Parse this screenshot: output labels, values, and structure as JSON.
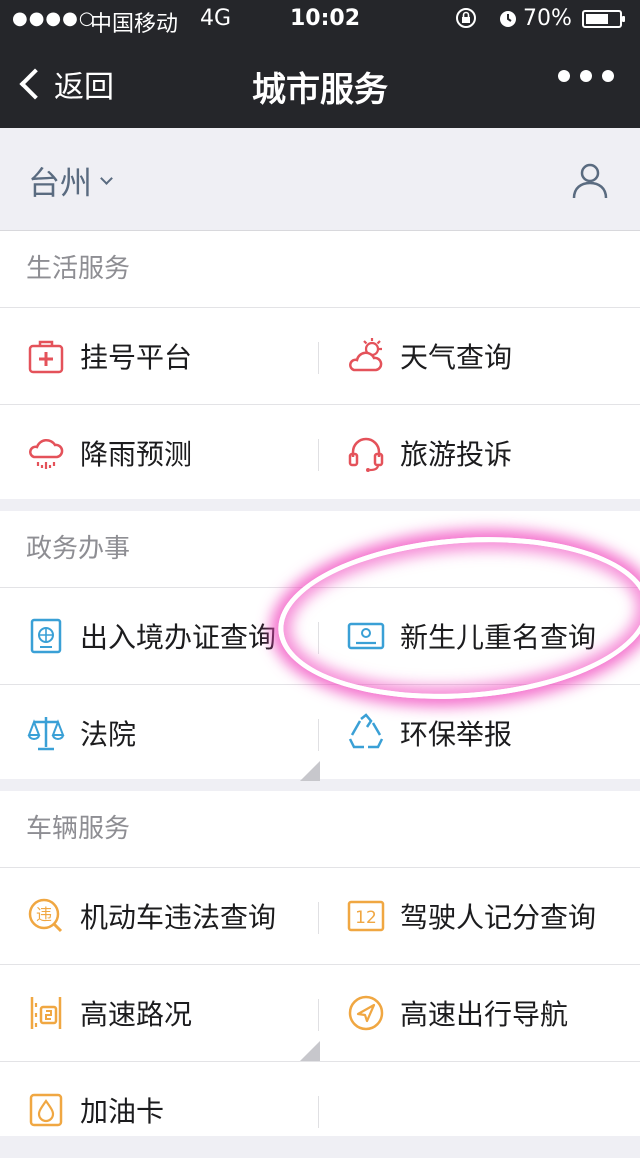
{
  "status_bar": {
    "signal": "●●●●○",
    "carrier": "中国移动",
    "network": "4G",
    "time": "10:02",
    "battery_percent": "70%",
    "battery_level": 0.7
  },
  "nav": {
    "back_label": "返回",
    "title": "城市服务"
  },
  "city": {
    "name": "台州"
  },
  "sections": [
    {
      "title": "生活服务",
      "items": [
        {
          "label": "挂号平台",
          "icon": "hospital-icon",
          "color": "#e4525a"
        },
        {
          "label": "天气查询",
          "icon": "weather-icon",
          "color": "#e4525a"
        },
        {
          "label": "降雨预测",
          "icon": "rain-icon",
          "color": "#e4525a"
        },
        {
          "label": "旅游投诉",
          "icon": "headset-icon",
          "color": "#e4525a"
        }
      ]
    },
    {
      "title": "政务办事",
      "items": [
        {
          "label": "出入境办证查询",
          "icon": "passport-icon",
          "color": "#3aa0d6"
        },
        {
          "label": "新生儿重名查询",
          "icon": "id-card-icon",
          "color": "#3aa0d6"
        },
        {
          "label": "法院",
          "icon": "scales-icon",
          "color": "#3aa0d6"
        },
        {
          "label": "环保举报",
          "icon": "recycle-icon",
          "color": "#3aa0d6"
        }
      ]
    },
    {
      "title": "车辆服务",
      "items": [
        {
          "label": "机动车违法查询",
          "icon": "violation-icon",
          "color": "#f0a742"
        },
        {
          "label": "驾驶人记分查询",
          "icon": "score-icon",
          "color": "#f0a742"
        },
        {
          "label": "高速路况",
          "icon": "highway-icon",
          "color": "#f0a742"
        },
        {
          "label": "高速出行导航",
          "icon": "navigation-icon",
          "color": "#f0a742"
        },
        {
          "label": "加油卡",
          "icon": "fuel-card-icon",
          "color": "#f0a742"
        }
      ]
    }
  ],
  "icon_text": {
    "violation": "违",
    "score": "12"
  }
}
